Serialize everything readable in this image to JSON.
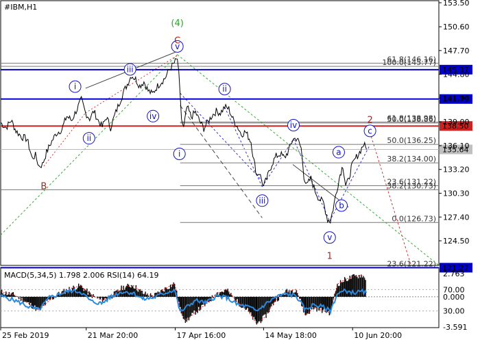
{
  "chart_data": {
    "type": "line",
    "title": "#IBM,H1",
    "ylim": [
      121.5,
      153.53
    ],
    "y_ticks": [
      {
        "value": 153.53,
        "label": "153.50"
      },
      {
        "value": 150.6,
        "label": "150.60"
      },
      {
        "value": 147.7,
        "label": "147.70"
      },
      {
        "value": 144.8,
        "label": "144.80"
      },
      {
        "value": 141.9,
        "label": "141.90"
      },
      {
        "value": 139.0,
        "label": "139.00"
      },
      {
        "value": 136.1,
        "label": "136.10"
      },
      {
        "value": 133.2,
        "label": "133.20"
      },
      {
        "value": 130.3,
        "label": "130.30"
      },
      {
        "value": 127.4,
        "label": "127.40"
      },
      {
        "value": 124.5,
        "label": "124.50"
      }
    ],
    "x_ticks": [
      {
        "bar": 0,
        "label": "25 Feb 2019"
      },
      {
        "bar": 123,
        "label": "21 Mar 20:00"
      },
      {
        "bar": 251,
        "label": "17 Apr 16:00"
      },
      {
        "bar": 378,
        "label": "14 May 18:00"
      },
      {
        "bar": 506,
        "label": "10 Jun 20:00"
      }
    ],
    "bars_visible": 630,
    "price_series": [
      {
        "bar": 0,
        "value": 138.9
      },
      {
        "bar": 8,
        "value": 138.3
      },
      {
        "bar": 15,
        "value": 139.2
      },
      {
        "bar": 22,
        "value": 137.9
      },
      {
        "bar": 30,
        "value": 137.2
      },
      {
        "bar": 38,
        "value": 136.9
      },
      {
        "bar": 45,
        "value": 134.6
      },
      {
        "bar": 50,
        "value": 134.9
      },
      {
        "bar": 55,
        "value": 133.6
      },
      {
        "bar": 60,
        "value": 133.8
      },
      {
        "bar": 66,
        "value": 135.3
      },
      {
        "bar": 72,
        "value": 136.4
      },
      {
        "bar": 80,
        "value": 137.6
      },
      {
        "bar": 88,
        "value": 138.1
      },
      {
        "bar": 95,
        "value": 139.7
      },
      {
        "bar": 102,
        "value": 139.2
      },
      {
        "bar": 110,
        "value": 140.6
      },
      {
        "bar": 116,
        "value": 141.7
      },
      {
        "bar": 122,
        "value": 140.1
      },
      {
        "bar": 128,
        "value": 139.4
      },
      {
        "bar": 134,
        "value": 140.3
      },
      {
        "bar": 140,
        "value": 139.2
      },
      {
        "bar": 146,
        "value": 138.4
      },
      {
        "bar": 152,
        "value": 139.6
      },
      {
        "bar": 158,
        "value": 138.3
      },
      {
        "bar": 164,
        "value": 139.8
      },
      {
        "bar": 170,
        "value": 141.2
      },
      {
        "bar": 176,
        "value": 142.5
      },
      {
        "bar": 182,
        "value": 143.6
      },
      {
        "bar": 188,
        "value": 144.7
      },
      {
        "bar": 194,
        "value": 144.2
      },
      {
        "bar": 200,
        "value": 143.4
      },
      {
        "bar": 206,
        "value": 143.9
      },
      {
        "bar": 212,
        "value": 142.8
      },
      {
        "bar": 218,
        "value": 142.4
      },
      {
        "bar": 224,
        "value": 143.2
      },
      {
        "bar": 230,
        "value": 143.8
      },
      {
        "bar": 236,
        "value": 144.3
      },
      {
        "bar": 242,
        "value": 145.3
      },
      {
        "bar": 248,
        "value": 146.0
      },
      {
        "bar": 254,
        "value": 146.7
      },
      {
        "bar": 256,
        "value": 144.8
      },
      {
        "bar": 258,
        "value": 142.0
      },
      {
        "bar": 260,
        "value": 139.4
      },
      {
        "bar": 263,
        "value": 138.2
      },
      {
        "bar": 268,
        "value": 140.8
      },
      {
        "bar": 274,
        "value": 139.6
      },
      {
        "bar": 280,
        "value": 140.2
      },
      {
        "bar": 286,
        "value": 139.1
      },
      {
        "bar": 292,
        "value": 138.2
      },
      {
        "bar": 298,
        "value": 139.0
      },
      {
        "bar": 304,
        "value": 139.8
      },
      {
        "bar": 310,
        "value": 140.3
      },
      {
        "bar": 316,
        "value": 140.1
      },
      {
        "bar": 322,
        "value": 140.8
      },
      {
        "bar": 328,
        "value": 140.6
      },
      {
        "bar": 334,
        "value": 139.3
      },
      {
        "bar": 340,
        "value": 138.5
      },
      {
        "bar": 346,
        "value": 137.5
      },
      {
        "bar": 352,
        "value": 137.8
      },
      {
        "bar": 356,
        "value": 137.2
      },
      {
        "bar": 360,
        "value": 136.6
      },
      {
        "bar": 364,
        "value": 134.3
      },
      {
        "bar": 368,
        "value": 132.6
      },
      {
        "bar": 372,
        "value": 132.8
      },
      {
        "bar": 378,
        "value": 131.1
      },
      {
        "bar": 384,
        "value": 132.4
      },
      {
        "bar": 390,
        "value": 133.9
      },
      {
        "bar": 396,
        "value": 134.8
      },
      {
        "bar": 402,
        "value": 135.1
      },
      {
        "bar": 408,
        "value": 134.6
      },
      {
        "bar": 414,
        "value": 135.5
      },
      {
        "bar": 420,
        "value": 136.9
      },
      {
        "bar": 426,
        "value": 137.0
      },
      {
        "bar": 432,
        "value": 135.8
      },
      {
        "bar": 436,
        "value": 132.4
      },
      {
        "bar": 440,
        "value": 131.2
      },
      {
        "bar": 446,
        "value": 132.1
      },
      {
        "bar": 452,
        "value": 130.6
      },
      {
        "bar": 458,
        "value": 129.6
      },
      {
        "bar": 464,
        "value": 129.2
      },
      {
        "bar": 470,
        "value": 127.1
      },
      {
        "bar": 474,
        "value": 126.9
      },
      {
        "bar": 478,
        "value": 128.4
      },
      {
        "bar": 482,
        "value": 130.2
      },
      {
        "bar": 488,
        "value": 132.6
      },
      {
        "bar": 492,
        "value": 133.7
      },
      {
        "bar": 496,
        "value": 131.3
      },
      {
        "bar": 500,
        "value": 131.8
      },
      {
        "bar": 504,
        "value": 133.4
      },
      {
        "bar": 510,
        "value": 134.5
      },
      {
        "bar": 516,
        "value": 135.3
      },
      {
        "bar": 522,
        "value": 136.3
      },
      {
        "bar": 526,
        "value": 135.64
      }
    ],
    "horizontal_levels": [
      {
        "value": 145.37,
        "label": "145.37",
        "color": "#0000cc",
        "style": "solid",
        "width": 2,
        "tag": "blue"
      },
      {
        "value": 141.79,
        "label": "141.79",
        "color": "#0000cc",
        "style": "solid",
        "width": 2,
        "tag": "blue"
      },
      {
        "value": 138.5,
        "label": "138.50",
        "color": "#cc2222",
        "style": "solid",
        "width": 2,
        "tag": "red"
      },
      {
        "value": 121.22,
        "label": "121.22",
        "color": "#0000cc",
        "style": "solid",
        "width": 2,
        "tag": "blue"
      }
    ],
    "current_price": {
      "value": 135.64,
      "label": "135.64",
      "color": "#c0c0c0"
    },
    "fib_levels": [
      {
        "value": 146.16,
        "label": "61.8(146.16)",
        "x_start_bar": 0
      },
      {
        "value": 145.77,
        "label": "100.0(145.77)",
        "x_start_bar": 0
      },
      {
        "value": 138.98,
        "label": "61.8(138.98)",
        "x_start_bar": 258
      },
      {
        "value": 138.86,
        "label": "50.0(138.86)",
        "x_start_bar": 258
      },
      {
        "value": 136.25,
        "label": "50.0(136.25)",
        "x_start_bar": 258
      },
      {
        "value": 134.0,
        "label": "38.2(134.00)",
        "x_start_bar": 258
      },
      {
        "value": 131.22,
        "label": "23.6(131.22)",
        "x_start_bar": 258
      },
      {
        "value": 130.73,
        "label": "38.2(130.73)",
        "x_start_bar": 0
      },
      {
        "value": 126.73,
        "label": "0.0(126.73)",
        "x_start_bar": 258
      },
      {
        "value": 121.22,
        "label": "23.6(121.22)",
        "x_start_bar": 258
      }
    ],
    "wave_labels": [
      {
        "text": "B",
        "bar": 62,
        "value": 131.2,
        "color": "#aa2222",
        "kind": "plain"
      },
      {
        "text": "i",
        "bar": 107,
        "value": 143.3,
        "kind": "circle"
      },
      {
        "text": "ii",
        "bar": 127,
        "value": 137.0,
        "kind": "circle"
      },
      {
        "text": "iii",
        "bar": 186,
        "value": 145.4,
        "kind": "circle"
      },
      {
        "text": "iv",
        "bar": 219,
        "value": 139.7,
        "kind": "circle"
      },
      {
        "text": "v",
        "bar": 254,
        "value": 148.2,
        "kind": "circle"
      },
      {
        "text": "(4)",
        "bar": 254,
        "value": 151.1,
        "color": "#22aa22",
        "kind": "plain"
      },
      {
        "text": "C",
        "bar": 254,
        "value": 149.0,
        "color": "#aa2222",
        "kind": "plain"
      },
      {
        "text": "i",
        "bar": 257,
        "value": 135.1,
        "kind": "circle"
      },
      {
        "text": "ii",
        "bar": 322,
        "value": 143.0,
        "kind": "circle"
      },
      {
        "text": "iii",
        "bar": 376,
        "value": 129.4,
        "kind": "circle"
      },
      {
        "text": "iv",
        "bar": 421,
        "value": 138.6,
        "kind": "circle"
      },
      {
        "text": "v",
        "bar": 473,
        "value": 124.9,
        "kind": "circle"
      },
      {
        "text": "1",
        "bar": 473,
        "value": 122.7,
        "color": "#aa2222",
        "kind": "plain"
      },
      {
        "text": "a",
        "bar": 486,
        "value": 135.3,
        "kind": "circle"
      },
      {
        "text": "b",
        "bar": 490,
        "value": 128.8,
        "kind": "circle"
      },
      {
        "text": "c",
        "bar": 531,
        "value": 137.9,
        "kind": "circle"
      },
      {
        "text": "2",
        "bar": 531,
        "value": 139.3,
        "color": "#aa2222",
        "kind": "plain"
      }
    ],
    "trend_lines": [
      {
        "from": [
          62,
          133.6
        ],
        "to": [
          122,
          140.1
        ],
        "color": "#cc3333",
        "dash": "2,3"
      },
      {
        "from": [
          122,
          140.1
        ],
        "to": [
          254,
          147.1
        ],
        "color": "#cc3333",
        "dash": "2,3"
      },
      {
        "from": [
          0,
          125.2
        ],
        "to": [
          254,
          147.2
        ],
        "color": "#33aa33",
        "dash": "3,3"
      },
      {
        "from": [
          254,
          147.2
        ],
        "to": [
          630,
          121.5
        ],
        "color": "#33aa33",
        "dash": "3,3"
      },
      {
        "from": [
          122,
          143.1
        ],
        "to": [
          254,
          147.6
        ],
        "color": "#444444",
        "dash": ""
      },
      {
        "from": [
          258,
          141.0
        ],
        "to": [
          376,
          127.3
        ],
        "color": "#444444",
        "dash": "6,4"
      },
      {
        "from": [
          258,
          142.5
        ],
        "to": [
          376,
          131.8
        ],
        "color": "#3333cc",
        "dash": "3,3"
      },
      {
        "from": [
          322,
          140.8
        ],
        "to": [
          376,
          131.1
        ],
        "color": "#3333cc",
        "dash": "3,3"
      },
      {
        "from": [
          376,
          131.1
        ],
        "to": [
          421,
          136.9
        ],
        "color": "#3333cc",
        "dash": "3,3"
      },
      {
        "from": [
          421,
          136.9
        ],
        "to": [
          473,
          126.9
        ],
        "color": "#3333cc",
        "dash": "3,3"
      },
      {
        "from": [
          473,
          126.9
        ],
        "to": [
          531,
          136.2
        ],
        "color": "#3333cc",
        "dash": "3,3"
      },
      {
        "from": [
          531,
          137.7
        ],
        "to": [
          590,
          121.5
        ],
        "color": "#cc3333",
        "dash": "3,3"
      },
      {
        "from": [
          420,
          133.8
        ],
        "to": [
          500,
          128.6
        ],
        "color": "#444444",
        "dash": ""
      }
    ]
  },
  "indicator": {
    "label": "MACD(5,34,5) 1.798 2.006 RSI(14) 64.19",
    "macd_ticks": [
      {
        "value": 2.763,
        "label": "2.763"
      },
      {
        "value": 0.0,
        "label": "0.000"
      },
      {
        "value": -3.591,
        "label": "-3.591"
      }
    ],
    "rsi_ticks": [
      {
        "value": 70.0,
        "label": "70.00"
      },
      {
        "value": 30.0,
        "label": "30.00"
      }
    ],
    "macd_hist": [
      {
        "bar": 0,
        "value": 0.6
      },
      {
        "bar": 20,
        "value": 0.2
      },
      {
        "bar": 40,
        "value": -0.8
      },
      {
        "bar": 55,
        "value": -1.6
      },
      {
        "bar": 70,
        "value": -0.4
      },
      {
        "bar": 85,
        "value": 0.4
      },
      {
        "bar": 100,
        "value": 1.0
      },
      {
        "bar": 115,
        "value": 1.3
      },
      {
        "bar": 130,
        "value": 0.2
      },
      {
        "bar": 145,
        "value": -0.4
      },
      {
        "bar": 160,
        "value": 0.1
      },
      {
        "bar": 175,
        "value": 1.1
      },
      {
        "bar": 190,
        "value": 1.4
      },
      {
        "bar": 205,
        "value": 0.4
      },
      {
        "bar": 220,
        "value": 0.1
      },
      {
        "bar": 235,
        "value": 0.9
      },
      {
        "bar": 250,
        "value": 1.6
      },
      {
        "bar": 258,
        "value": -1.5
      },
      {
        "bar": 266,
        "value": -2.9
      },
      {
        "bar": 280,
        "value": -1.8
      },
      {
        "bar": 295,
        "value": -0.9
      },
      {
        "bar": 310,
        "value": 0.4
      },
      {
        "bar": 325,
        "value": 0.8
      },
      {
        "bar": 340,
        "value": -0.6
      },
      {
        "bar": 355,
        "value": -1.6
      },
      {
        "bar": 368,
        "value": -3.2
      },
      {
        "bar": 380,
        "value": -2.4
      },
      {
        "bar": 395,
        "value": -0.4
      },
      {
        "bar": 410,
        "value": 0.6
      },
      {
        "bar": 425,
        "value": 0.9
      },
      {
        "bar": 438,
        "value": -2.2
      },
      {
        "bar": 450,
        "value": -1.3
      },
      {
        "bar": 462,
        "value": -1.6
      },
      {
        "bar": 474,
        "value": -1.9
      },
      {
        "bar": 484,
        "value": 1.5
      },
      {
        "bar": 496,
        "value": 2.1
      },
      {
        "bar": 508,
        "value": 2.4
      },
      {
        "bar": 520,
        "value": 2.6
      },
      {
        "bar": 526,
        "value": 1.8
      }
    ],
    "rsi_series": [
      {
        "bar": 0,
        "value": 58
      },
      {
        "bar": 20,
        "value": 50
      },
      {
        "bar": 40,
        "value": 38
      },
      {
        "bar": 55,
        "value": 32
      },
      {
        "bar": 70,
        "value": 55
      },
      {
        "bar": 85,
        "value": 62
      },
      {
        "bar": 100,
        "value": 68
      },
      {
        "bar": 115,
        "value": 66
      },
      {
        "bar": 130,
        "value": 48
      },
      {
        "bar": 145,
        "value": 44
      },
      {
        "bar": 160,
        "value": 58
      },
      {
        "bar": 175,
        "value": 66
      },
      {
        "bar": 190,
        "value": 64
      },
      {
        "bar": 205,
        "value": 52
      },
      {
        "bar": 220,
        "value": 55
      },
      {
        "bar": 235,
        "value": 63
      },
      {
        "bar": 250,
        "value": 70
      },
      {
        "bar": 258,
        "value": 28
      },
      {
        "bar": 266,
        "value": 36
      },
      {
        "bar": 280,
        "value": 50
      },
      {
        "bar": 295,
        "value": 45
      },
      {
        "bar": 310,
        "value": 58
      },
      {
        "bar": 325,
        "value": 55
      },
      {
        "bar": 340,
        "value": 42
      },
      {
        "bar": 355,
        "value": 38
      },
      {
        "bar": 368,
        "value": 30
      },
      {
        "bar": 380,
        "value": 42
      },
      {
        "bar": 395,
        "value": 56
      },
      {
        "bar": 410,
        "value": 62
      },
      {
        "bar": 425,
        "value": 58
      },
      {
        "bar": 438,
        "value": 32
      },
      {
        "bar": 450,
        "value": 42
      },
      {
        "bar": 462,
        "value": 38
      },
      {
        "bar": 474,
        "value": 30
      },
      {
        "bar": 484,
        "value": 62
      },
      {
        "bar": 496,
        "value": 68
      },
      {
        "bar": 508,
        "value": 64
      },
      {
        "bar": 520,
        "value": 66
      },
      {
        "bar": 526,
        "value": 64.19
      }
    ]
  }
}
